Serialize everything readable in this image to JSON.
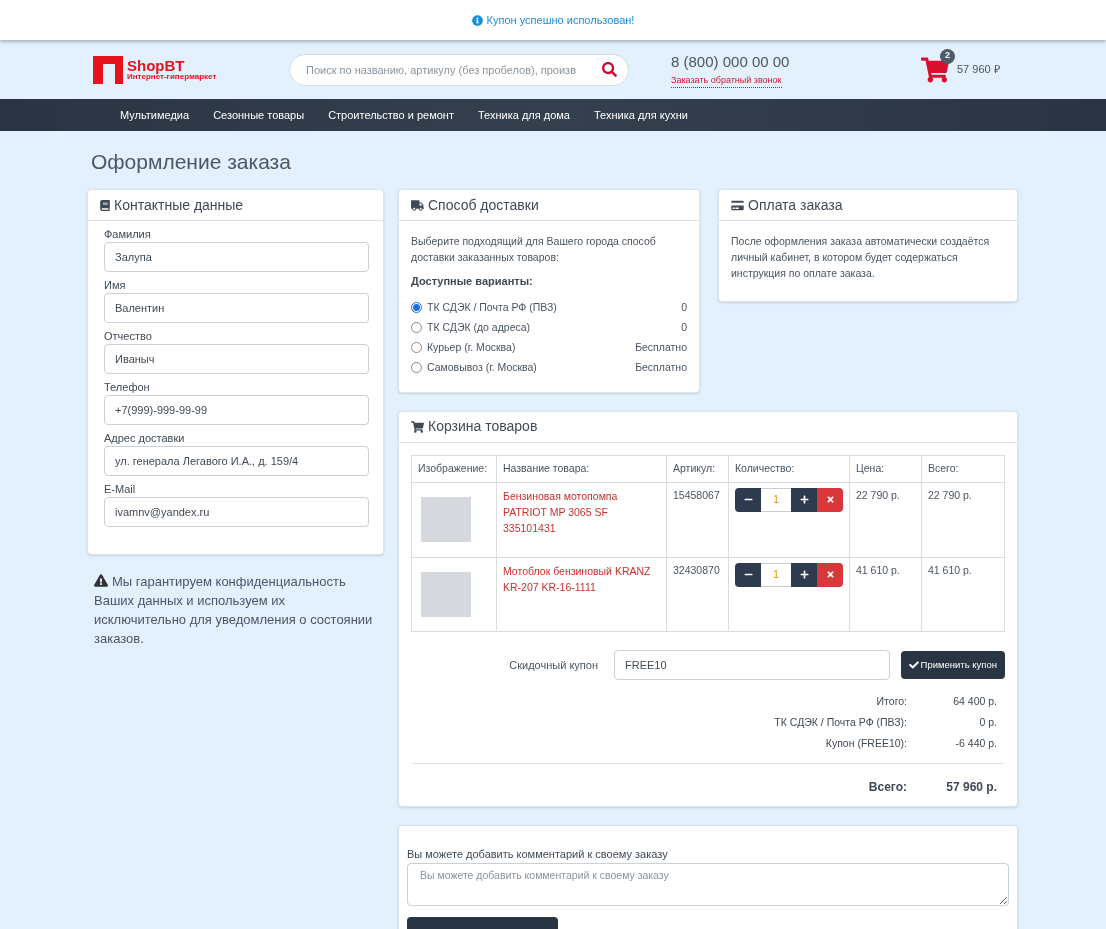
{
  "notice": {
    "text": "Купон успешно использован!"
  },
  "header": {
    "logo_name": "ShopBT",
    "logo_tagline": "Интернет-гипермаркет",
    "search": {
      "placeholder": "Поиск по названию, артикулу (без пробелов), произв"
    },
    "phone": "8 (800) 000 00 00",
    "callback_link": "Заказать обратный звонок",
    "cart": {
      "count": "2",
      "total": "57 960 ₽"
    }
  },
  "nav": [
    {
      "label": "Мультимедиа"
    },
    {
      "label": "Сезонные товары"
    },
    {
      "label": "Строительство и ремонт"
    },
    {
      "label": "Техника для дома"
    },
    {
      "label": "Техника для кухни"
    }
  ],
  "page_title": "Оформление заказа",
  "contacts": {
    "title": "Контактные данные",
    "fields": [
      {
        "label": "Фамилия",
        "value": "Залупа"
      },
      {
        "label": "Имя",
        "value": "Валентин"
      },
      {
        "label": "Отчество",
        "value": "Иваныч"
      },
      {
        "label": "Телефон",
        "value": "+7(999)-999-99-99"
      },
      {
        "label": "Адрес доставки",
        "value": "ул. генерала Легавого И.А., д. 159/4"
      },
      {
        "label": "E-Mail",
        "value": "ivamnv@yandex.ru"
      }
    ],
    "privacy_note": "Мы гарантируем конфиденциальность Ваших данных и используем их исключительно для уведомления о состоянии заказов."
  },
  "delivery": {
    "title": "Способ доставки",
    "intro": "Выберите подходящий для Вашего города способ доставки заказанных товаров:",
    "options_heading": "Доступные варианты:",
    "options": [
      {
        "label": "ТК СДЭК / Почта РФ (ПВЗ)",
        "price": "0",
        "selected": true
      },
      {
        "label": "ТК СДЭК (до адреса)",
        "price": "0",
        "selected": false
      },
      {
        "label": "Курьер (г. Москва)",
        "price": "Бесплатно",
        "selected": false
      },
      {
        "label": "Самовывоз (г. Москва)",
        "price": "Бесплатно",
        "selected": false
      }
    ]
  },
  "payment": {
    "title": "Оплата заказа",
    "text": "После оформления заказа автоматически создаётся личный кабинет, в котором будет содержаться инструкция по оплате заказа."
  },
  "cart": {
    "title": "Корзина товаров",
    "columns": [
      "Изображение:",
      "Название товара:",
      "Артикул:",
      "Количество:",
      "Цена:",
      "Всего:"
    ],
    "rows": [
      {
        "name": "Бензиновая мотопомпа PATRIOT MP 3065 SF 335101431",
        "sku": "15458067",
        "qty": "1",
        "price": "22 790 р.",
        "total": "22 790 р."
      },
      {
        "name": "Мотоблок бензиновый KRANZ KR-207 KR-16-1111",
        "sku": "32430870",
        "qty": "1",
        "price": "41 610 р.",
        "total": "41 610 р."
      }
    ],
    "coupon": {
      "label": "Скидочный купон",
      "value": "FREE10",
      "button": "Применить купон"
    },
    "summary": [
      {
        "label": "Итого:",
        "value": "64 400 р."
      },
      {
        "label": "ТК СДЭК / Почта РФ (ПВЗ):",
        "value": "0 р."
      },
      {
        "label": "Купон (FREE10):",
        "value": "-6 440 р."
      }
    ],
    "grand_total": {
      "label": "Всего:",
      "value": "57 960 р."
    }
  },
  "comment": {
    "label": "Вы можете добавить комментарий к своему заказу",
    "placeholder": "Вы можете добавить комментарий к своему заказу"
  }
}
